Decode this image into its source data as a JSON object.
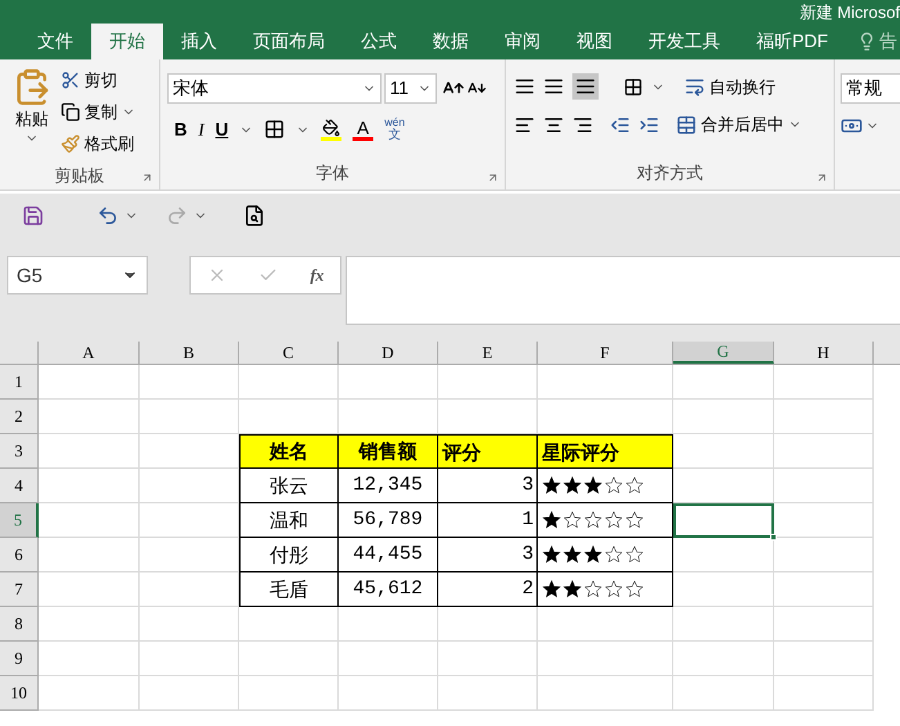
{
  "title": "新建 Microsof",
  "tabs": [
    {
      "label": "文件",
      "selected": false
    },
    {
      "label": "开始",
      "selected": true
    },
    {
      "label": "插入",
      "selected": false
    },
    {
      "label": "页面布局",
      "selected": false
    },
    {
      "label": "公式",
      "selected": false
    },
    {
      "label": "数据",
      "selected": false
    },
    {
      "label": "审阅",
      "selected": false
    },
    {
      "label": "视图",
      "selected": false
    },
    {
      "label": "开发工具",
      "selected": false
    },
    {
      "label": "福昕PDF",
      "selected": false
    }
  ],
  "tell_me": "告",
  "clipboard": {
    "paste": "粘贴",
    "cut": "剪切",
    "copy": "复制",
    "format_painter": "格式刷",
    "label": "剪贴板"
  },
  "font": {
    "name": "宋体",
    "size": "11",
    "bold": "B",
    "italic": "I",
    "underline": "U",
    "color_letter": "A",
    "phonetic": "wén",
    "phonetic_char": "文",
    "label": "字体"
  },
  "alignment": {
    "wrap": "自动换行",
    "merge": "合并后居中",
    "label": "对齐方式"
  },
  "number": {
    "format": "常规"
  },
  "name_box": "G5",
  "fx": "fx",
  "columns": [
    {
      "label": "A",
      "selected": false
    },
    {
      "label": "B",
      "selected": false
    },
    {
      "label": "C",
      "selected": false
    },
    {
      "label": "D",
      "selected": false
    },
    {
      "label": "E",
      "selected": false
    },
    {
      "label": "F",
      "selected": false
    },
    {
      "label": "G",
      "selected": true
    },
    {
      "label": "H",
      "selected": false
    }
  ],
  "rows": [
    {
      "label": "1",
      "selected": false
    },
    {
      "label": "2",
      "selected": false
    },
    {
      "label": "3",
      "selected": false
    },
    {
      "label": "4",
      "selected": false
    },
    {
      "label": "5",
      "selected": true
    },
    {
      "label": "6",
      "selected": false
    },
    {
      "label": "7",
      "selected": false
    },
    {
      "label": "8",
      "selected": false
    },
    {
      "label": "9",
      "selected": false
    },
    {
      "label": "10",
      "selected": false
    }
  ],
  "table": {
    "header": [
      "姓名",
      "销售额",
      "评分",
      "星际评分"
    ],
    "records": [
      {
        "name": "张云",
        "sales": "12,345",
        "score": "3",
        "stars": 3
      },
      {
        "name": "温和",
        "sales": "56,789",
        "score": "1",
        "stars": 1
      },
      {
        "name": "付彤",
        "sales": "44,455",
        "score": "3",
        "stars": 3
      },
      {
        "name": "毛盾",
        "sales": "45,612",
        "score": "2",
        "stars": 2
      }
    ]
  }
}
